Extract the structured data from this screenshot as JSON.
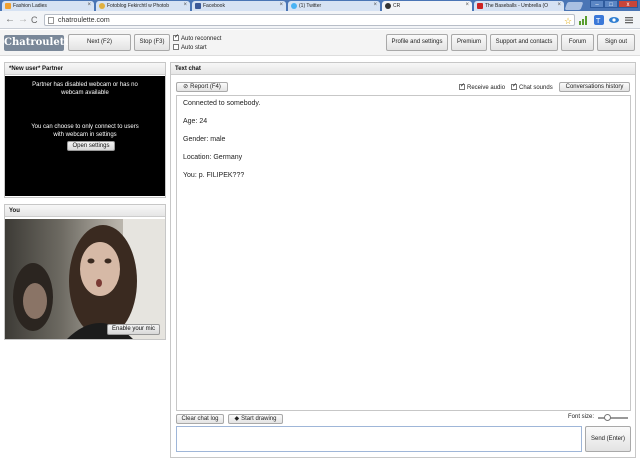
{
  "browser": {
    "tabs": [
      {
        "title": "Fashion Ladies",
        "active": false,
        "color": "#f0a030"
      },
      {
        "title": "Fotoblog Fekirchtl w Photob",
        "active": false,
        "color": "#e0b040"
      },
      {
        "title": "Facebook",
        "active": false,
        "color": "#3b5998"
      },
      {
        "title": "(1) Twitter",
        "active": false,
        "color": "#4ab3f4"
      },
      {
        "title": "CR",
        "active": true,
        "color": "#333333"
      },
      {
        "title": "The Baseballs - Umbrella (O",
        "active": false,
        "color": "#cc2222"
      }
    ],
    "window_buttons": {
      "minimize": "–",
      "maximize": "□",
      "close": "x"
    },
    "back": "←",
    "forward": "→",
    "reload": "C",
    "url": "chatroulette.com"
  },
  "header": {
    "logo": "Chatroulette",
    "next_button": "Next (F2)",
    "stop_button": "Stop (F3)",
    "auto_reconnect": {
      "label": "Auto reconnect",
      "checked": true
    },
    "auto_start": {
      "label": "Auto start",
      "checked": false
    },
    "nav": [
      "Profile and settings",
      "Premium",
      "Support and contacts",
      "Forum",
      "Sign out"
    ]
  },
  "partner": {
    "title": "*New user* Partner",
    "message_1": "Partner has disabled webcam or has no webcam available",
    "message_2": "You can choose to only connect to users with webcam in settings",
    "open_settings_button": "Open settings"
  },
  "you": {
    "title": "You",
    "enable_mic_button": "Enable your mic"
  },
  "chat": {
    "title": "Text chat",
    "report_button": "Report (F4)",
    "receive_audio": {
      "label": "Receive audio",
      "checked": true
    },
    "chat_sounds": {
      "label": "Chat sounds",
      "checked": true
    },
    "history_button": "Conversations history",
    "messages": [
      "Connected to somebody.",
      "Age: 24",
      "Gender: male",
      "Location: Germany",
      "You: p. FILIPEK???"
    ],
    "clear_button": "Clear chat log",
    "draw_button": "Start drawing",
    "font_size_label": "Font size:",
    "font_size_level": 0.25,
    "send_button": "Send (Enter)"
  },
  "colors": {
    "tabstrip": "#4a75b5",
    "logo_bg": "#7a8899",
    "input_border": "#9fb6d8"
  }
}
